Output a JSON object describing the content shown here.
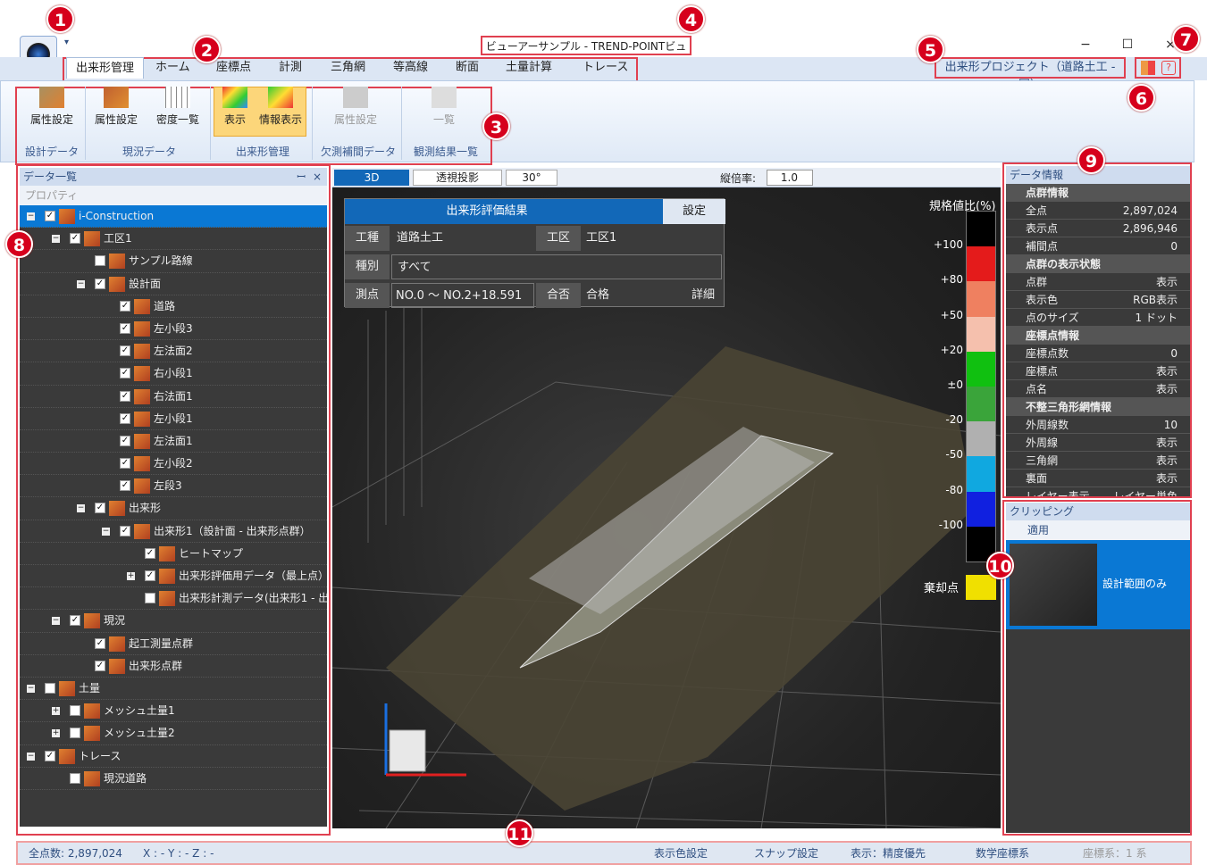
{
  "window": {
    "title": "ビューアーサンプル - TREND-POINTビューアー",
    "minimize": "−",
    "maximize": "☐",
    "close": "×",
    "quick_access": "▾"
  },
  "ribbon": {
    "tabs": [
      "出来形管理",
      "ホーム",
      "座標点",
      "計測",
      "三角網",
      "等高線",
      "断面",
      "土量計算",
      "トレース"
    ],
    "project_label": "出来形プロジェクト（道路土工 - 国）",
    "buttons": {
      "attr_design": "属性設定",
      "attr_current": "属性設定",
      "density_list": "密度一覧",
      "display": "表示",
      "info_display": "情報表示",
      "attr_missing": "属性設定",
      "list": "一覧"
    },
    "groups": {
      "design_data": "設計データ",
      "current_data": "現況データ",
      "dekigata_mgmt": "出来形管理",
      "missing_data": "欠測補間データ",
      "observation_list": "観測結果一覧"
    }
  },
  "data_panel": {
    "title": "データ一覧",
    "pin": "ꟷ",
    "close": "×",
    "property": "プロパティ",
    "tree": [
      {
        "label": "i-Construction",
        "level": 0,
        "expand": "−",
        "checked": true,
        "selected": true
      },
      {
        "label": "工区1",
        "level": 1,
        "expand": "−",
        "checked": true
      },
      {
        "label": "サンプル路線",
        "level": 2,
        "checked": false
      },
      {
        "label": "設計面",
        "level": 2,
        "expand": "−",
        "checked": true
      },
      {
        "label": "道路",
        "level": 3,
        "checked": true
      },
      {
        "label": "左小段3",
        "level": 3,
        "checked": true
      },
      {
        "label": "左法面2",
        "level": 3,
        "checked": true
      },
      {
        "label": "右小段1",
        "level": 3,
        "checked": true
      },
      {
        "label": "右法面1",
        "level": 3,
        "checked": true
      },
      {
        "label": "左小段1",
        "level": 3,
        "checked": true
      },
      {
        "label": "左法面1",
        "level": 3,
        "checked": true
      },
      {
        "label": "左小段2",
        "level": 3,
        "checked": true
      },
      {
        "label": "左段3",
        "level": 3,
        "checked": true
      },
      {
        "label": "出来形",
        "level": 2,
        "expand": "−",
        "checked": true
      },
      {
        "label": "出来形1（設計面 - 出来形点群）",
        "level": 3,
        "expand": "−",
        "checked": true
      },
      {
        "label": "ヒートマップ",
        "level": 4,
        "checked": true
      },
      {
        "label": "出来形評価用データ（最上点）",
        "level": 4,
        "expand": "+",
        "checked": true
      },
      {
        "label": "出来形計測データ(出来形1 - 出",
        "level": 4,
        "checked": false
      },
      {
        "label": "現況",
        "level": 1,
        "expand": "−",
        "checked": true
      },
      {
        "label": "起工測量点群",
        "level": 2,
        "checked": true
      },
      {
        "label": "出来形点群",
        "level": 2,
        "checked": true
      },
      {
        "label": "土量",
        "level": 0,
        "expand": "−",
        "checked": false
      },
      {
        "label": "メッシュ土量1",
        "level": 1,
        "expand": "+",
        "checked": false
      },
      {
        "label": "メッシュ土量2",
        "level": 1,
        "expand": "+",
        "checked": false
      },
      {
        "label": "トレース",
        "level": 0,
        "expand": "−",
        "checked": true
      },
      {
        "label": "現況道路",
        "level": 1,
        "checked": false
      }
    ]
  },
  "viewport": {
    "mode": "3D",
    "perspective": "透視投影",
    "angle": "30°",
    "scale_label": "縦倍率:",
    "scale_value": "1.0",
    "eval_panel": {
      "title": "出来形評価結果",
      "settings": "設定",
      "work_type_label": "工種",
      "work_type": "道路土工",
      "section_label": "工区",
      "section": "工区1",
      "kind_label": "種別",
      "kind": "すべて",
      "point_label": "測点",
      "point": "NO.0 〜 NO.2+18.591",
      "pass_label": "合否",
      "pass": "合格",
      "detail": "詳細"
    },
    "legend": {
      "title": "規格値比(%)",
      "ticks": [
        "+100",
        "+80",
        "+50",
        "+20",
        "±0",
        "-20",
        "-50",
        "-80",
        "-100"
      ],
      "colors": [
        "#000000",
        "#e41b1b",
        "#ef8060",
        "#f5c0ad",
        "#10c010",
        "#3aa43a",
        "#b0b0b0",
        "#10a8e0",
        "#1020e0",
        "#000000"
      ],
      "reject_label": "棄却点",
      "reject_color": "#f0e000"
    }
  },
  "info_panel": {
    "title": "データ情報",
    "rows": [
      {
        "cat": "点群情報"
      },
      {
        "k": "全点",
        "v": "2,897,024"
      },
      {
        "k": "表示点",
        "v": "2,896,946"
      },
      {
        "k": "補間点",
        "v": "0"
      },
      {
        "cat": "点群の表示状態"
      },
      {
        "k": "点群",
        "v": "表示"
      },
      {
        "k": "表示色",
        "v": "RGB表示"
      },
      {
        "k": "点のサイズ",
        "v": "1 ドット"
      },
      {
        "cat": "座標点情報"
      },
      {
        "k": "座標点数",
        "v": "0"
      },
      {
        "k": "座標点",
        "v": "表示"
      },
      {
        "k": "点名",
        "v": "表示"
      },
      {
        "cat": "不整三角形網情報"
      },
      {
        "k": "外周線数",
        "v": "10"
      },
      {
        "k": "外周線",
        "v": "表示"
      },
      {
        "k": "三角網",
        "v": "表示"
      },
      {
        "k": "裏面",
        "v": "表示"
      },
      {
        "k": "レイヤー表示",
        "v": "レイヤー単色"
      }
    ]
  },
  "clip_panel": {
    "title": "クリッピング",
    "apply": "適用",
    "option": "設計範囲のみ"
  },
  "status": {
    "total": "全点数: 2,897,024",
    "coords": "X : -  Y : -  Z : -",
    "color_settings": "表示色設定",
    "snap_settings": "スナップ設定",
    "display_mode": "表示：精度優先",
    "coord_system": "数学座標系",
    "coord_zone": "座標系：1 系"
  },
  "callouts": [
    "1",
    "2",
    "3",
    "4",
    "5",
    "6",
    "7",
    "8",
    "9",
    "10",
    "11"
  ],
  "accent": "#0a78d4",
  "callout_color": "#d6001c"
}
